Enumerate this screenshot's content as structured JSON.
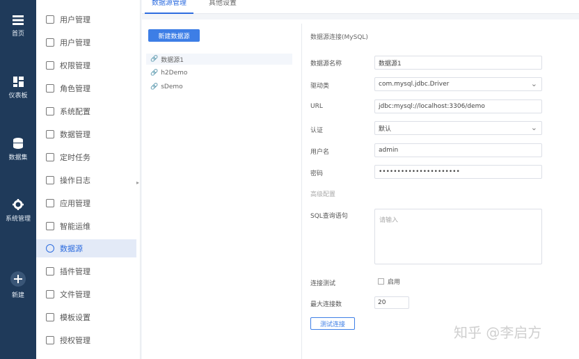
{
  "rail": [
    {
      "label": "首页",
      "icon": "menu-icon"
    },
    {
      "label": "仪表板",
      "icon": "dashboard-icon"
    },
    {
      "label": "数据集",
      "icon": "database-icon"
    },
    {
      "label": "系统管理",
      "icon": "gear-icon"
    },
    {
      "label": "新建",
      "icon": "plus-icon"
    }
  ],
  "sidebar": {
    "items": [
      {
        "label": "用户管理"
      },
      {
        "label": "用户管理"
      },
      {
        "label": "权限管理"
      },
      {
        "label": "角色管理"
      },
      {
        "label": "系统配置"
      },
      {
        "label": "数据管理"
      },
      {
        "label": "定时任务"
      },
      {
        "label": "操作日志"
      },
      {
        "label": "应用管理"
      },
      {
        "label": "智能运维"
      },
      {
        "label": "数据源"
      },
      {
        "label": "插件管理"
      },
      {
        "label": "文件管理"
      },
      {
        "label": "模板设置"
      },
      {
        "label": "授权管理"
      }
    ],
    "active_index": 10
  },
  "tabs": [
    {
      "label": "数据源管理"
    },
    {
      "label": "其他设置"
    }
  ],
  "datasource": {
    "add_button": "新建数据源",
    "items": [
      {
        "label": "数据源1"
      },
      {
        "label": "h2Demo"
      },
      {
        "label": "sDemo"
      }
    ]
  },
  "form": {
    "title": "数据源连接(MySQL)",
    "name_label": "数据源名称",
    "name_value": "数据源1",
    "driver_label": "驱动类",
    "driver_value": "com.mysql.jdbc.Driver",
    "url_label": "URL",
    "url_value": "jdbc:mysql://localhost:3306/demo",
    "auth_label": "认证",
    "auth_value": "默认",
    "user_label": "用户名",
    "user_value": "admin",
    "pwd_label": "密码",
    "pwd_value": "••••••••••••••••••••••",
    "advanced_label": "高级配置",
    "sql_label": "SQL查询语句",
    "sql_placeholder": "请输入",
    "check_label": "连接测试",
    "check_text": "启用",
    "max_label": "最大连接数",
    "max_value": "20",
    "test_button": "测试连接"
  },
  "watermark": "知乎 @李启方"
}
